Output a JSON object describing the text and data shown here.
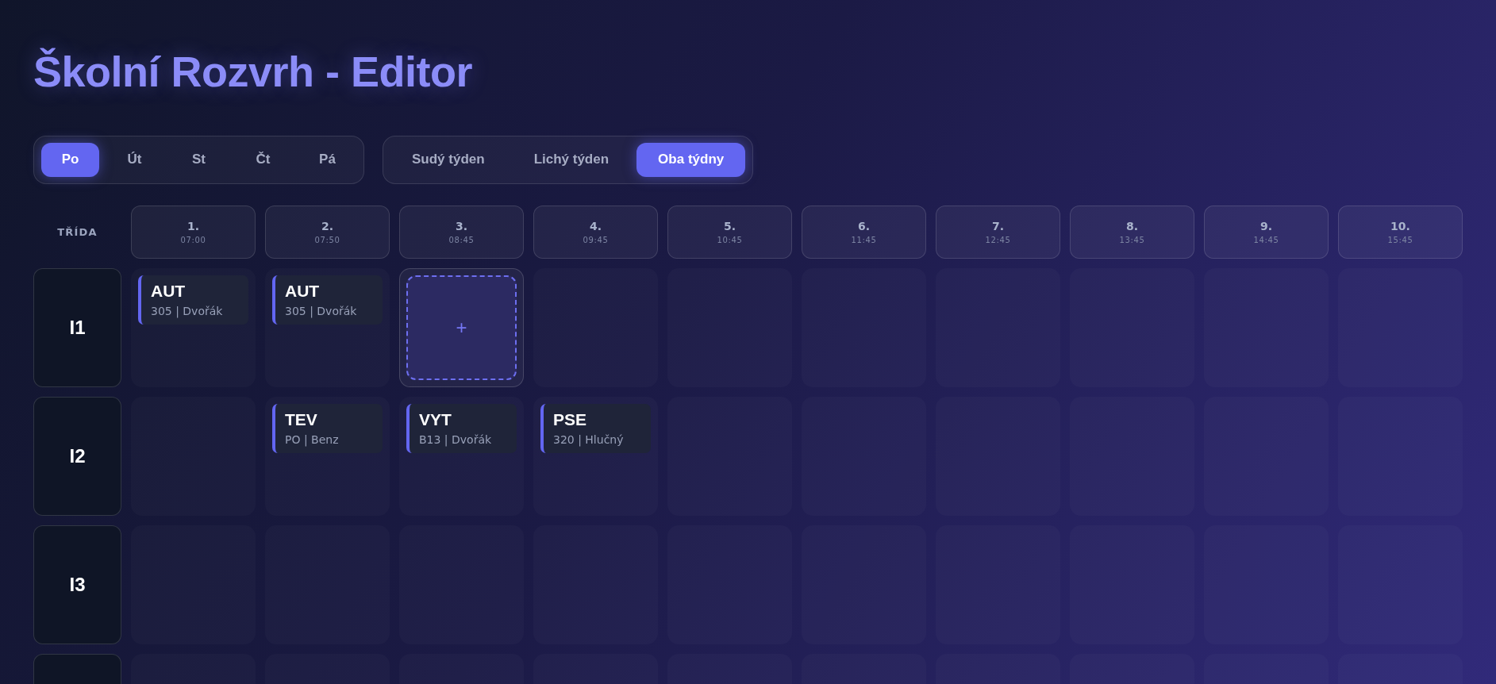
{
  "title": "Školní Rozvrh - Editor",
  "days": [
    {
      "label": "Po",
      "selected": true
    },
    {
      "label": "Út",
      "selected": false
    },
    {
      "label": "St",
      "selected": false
    },
    {
      "label": "Čt",
      "selected": false
    },
    {
      "label": "Pá",
      "selected": false
    }
  ],
  "weeks": [
    {
      "label": "Sudý týden",
      "selected": false
    },
    {
      "label": "Lichý týden",
      "selected": false
    },
    {
      "label": "Oba týdny",
      "selected": true
    }
  ],
  "grid": {
    "corner_label": "TŘÍDA",
    "periods": [
      {
        "number": "1.",
        "time": "07:00"
      },
      {
        "number": "2.",
        "time": "07:50"
      },
      {
        "number": "3.",
        "time": "08:45"
      },
      {
        "number": "4.",
        "time": "09:45"
      },
      {
        "number": "5.",
        "time": "10:45"
      },
      {
        "number": "6.",
        "time": "11:45"
      },
      {
        "number": "7.",
        "time": "12:45"
      },
      {
        "number": "8.",
        "time": "13:45"
      },
      {
        "number": "9.",
        "time": "14:45"
      },
      {
        "number": "10.",
        "time": "15:45"
      }
    ],
    "rows": [
      {
        "class": "I1",
        "cells": [
          {
            "kind": "lesson",
            "subject": "AUT",
            "detail": "305 | Dvořák"
          },
          {
            "kind": "lesson",
            "subject": "AUT",
            "detail": "305 | Dvořák"
          },
          {
            "kind": "add",
            "symbol": "+"
          },
          {
            "kind": "empty"
          },
          {
            "kind": "empty"
          },
          {
            "kind": "empty"
          },
          {
            "kind": "empty"
          },
          {
            "kind": "empty"
          },
          {
            "kind": "empty"
          },
          {
            "kind": "empty"
          }
        ]
      },
      {
        "class": "I2",
        "cells": [
          {
            "kind": "empty"
          },
          {
            "kind": "lesson",
            "subject": "TEV",
            "detail": "PO | Benz"
          },
          {
            "kind": "lesson",
            "subject": "VYT",
            "detail": "B13 | Dvořák"
          },
          {
            "kind": "lesson",
            "subject": "PSE",
            "detail": "320 | Hlučný"
          },
          {
            "kind": "empty"
          },
          {
            "kind": "empty"
          },
          {
            "kind": "empty"
          },
          {
            "kind": "empty"
          },
          {
            "kind": "empty"
          },
          {
            "kind": "empty"
          }
        ]
      },
      {
        "class": "I3",
        "cells": [
          {
            "kind": "empty"
          },
          {
            "kind": "empty"
          },
          {
            "kind": "empty"
          },
          {
            "kind": "empty"
          },
          {
            "kind": "empty"
          },
          {
            "kind": "empty"
          },
          {
            "kind": "empty"
          },
          {
            "kind": "empty"
          },
          {
            "kind": "empty"
          },
          {
            "kind": "empty"
          }
        ]
      },
      {
        "cells": [
          {
            "kind": "empty"
          },
          {
            "kind": "empty"
          },
          {
            "kind": "empty"
          },
          {
            "kind": "empty"
          },
          {
            "kind": "empty"
          },
          {
            "kind": "empty"
          },
          {
            "kind": "empty"
          },
          {
            "kind": "empty"
          },
          {
            "kind": "empty"
          },
          {
            "kind": "empty"
          }
        ]
      }
    ]
  }
}
